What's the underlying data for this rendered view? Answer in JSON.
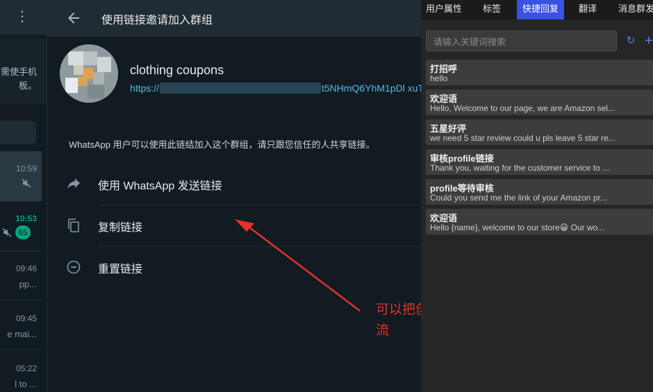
{
  "left": {
    "notice_lines": [
      "需使手机",
      "板。"
    ],
    "chats": [
      {
        "time": "10:59",
        "snippet": ""
      },
      {
        "time": "10:53",
        "snippet": "",
        "unread": "65"
      },
      {
        "time": "09:46",
        "snippet": "pp..."
      },
      {
        "time": "09:45",
        "snippet": "e mai..."
      },
      {
        "time": "05:22",
        "snippet": "l to ..."
      }
    ]
  },
  "main": {
    "header_title": "使用链接邀请加入群组",
    "group_name": "clothing coupons",
    "link_start": "https://",
    "link_end": "t5NHmQ6YhM1pDl      xuT",
    "description": "WhatsApp 用户可以使用此链结加入这个群组，请只跟您信任的人共享链接。",
    "actions": [
      {
        "label": "使用 WhatsApp 发送链接",
        "icon": "share-icon"
      },
      {
        "label": "复制链接",
        "icon": "copy-icon"
      },
      {
        "label": "重置链接",
        "icon": "reset-icon"
      }
    ]
  },
  "annotation": "可以把创建的社群链接发出去，让用户进群交流",
  "quick_reply": {
    "tabs": [
      "用户属性",
      "标签",
      "快捷回复",
      "翻译",
      "消息群发"
    ],
    "active_tab": "快捷回复",
    "search_placeholder": "请输入关键词搜索",
    "replies": [
      {
        "title": "打招呼",
        "body": "hello"
      },
      {
        "title": "欢迎语",
        "body": "Hello, Welcome to our page, we are Amazon sel..."
      },
      {
        "title": "五星好评",
        "body": "we need 5 star review could u pls leave 5 star re..."
      },
      {
        "title": "审核profile链接",
        "body": "Thank you, waiting for the customer service to ..."
      },
      {
        "title": "profile等待审核",
        "body": "Could you send me the link of your Amazon pr..."
      },
      {
        "title": "欢迎语",
        "body": "Hello {name}, welcome to our store😀 Our wo..."
      }
    ]
  },
  "colors": {
    "accent_blue": "#3a52e4",
    "whatsapp_green": "#00a884",
    "annotation_red": "#e8302a",
    "link_blue": "#53bdeb"
  }
}
